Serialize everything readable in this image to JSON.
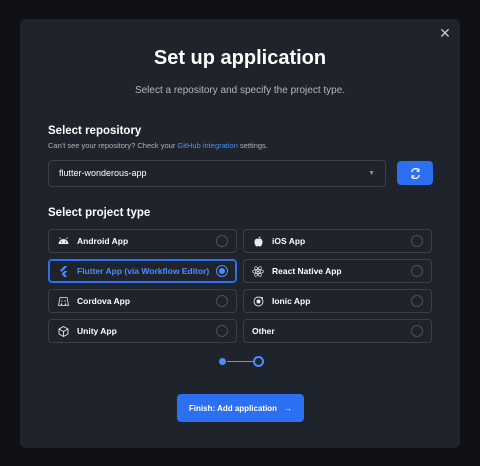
{
  "modal": {
    "close_icon": "close-icon",
    "close_glyph": "✕",
    "title": "Set up application",
    "subtitle": "Select a repository and specify the project type."
  },
  "repository": {
    "section_title": "Select repository",
    "hint_prefix": "Can't see your repository? Check your ",
    "hint_link": "GitHub integration",
    "hint_suffix": " settings.",
    "selected": "flutter-wonderous-app",
    "chevron": "▼",
    "refresh_icon": "refresh-icon"
  },
  "project_type": {
    "section_title": "Select project type",
    "options": [
      {
        "label": "Android App",
        "icon": "android-icon",
        "selected": false
      },
      {
        "label": "iOS App",
        "icon": "apple-icon",
        "selected": false
      },
      {
        "label": "Flutter App (via Workflow Editor)",
        "icon": "flutter-icon",
        "selected": true
      },
      {
        "label": "React Native App",
        "icon": "react-icon",
        "selected": false
      },
      {
        "label": "Cordova App",
        "icon": "cordova-icon",
        "selected": false
      },
      {
        "label": "Ionic App",
        "icon": "ionic-icon",
        "selected": false
      },
      {
        "label": "Unity App",
        "icon": "unity-icon",
        "selected": false
      },
      {
        "label": "Other",
        "icon": "",
        "selected": false
      }
    ]
  },
  "stepper": {
    "current_step": 1,
    "total_steps": 2
  },
  "footer": {
    "finish_label": "Finish: Add application",
    "arrow": "→"
  },
  "colors": {
    "accent": "#2c6ff0",
    "link": "#4f8df9",
    "panel": "#1f232b",
    "background": "#0f1114"
  }
}
